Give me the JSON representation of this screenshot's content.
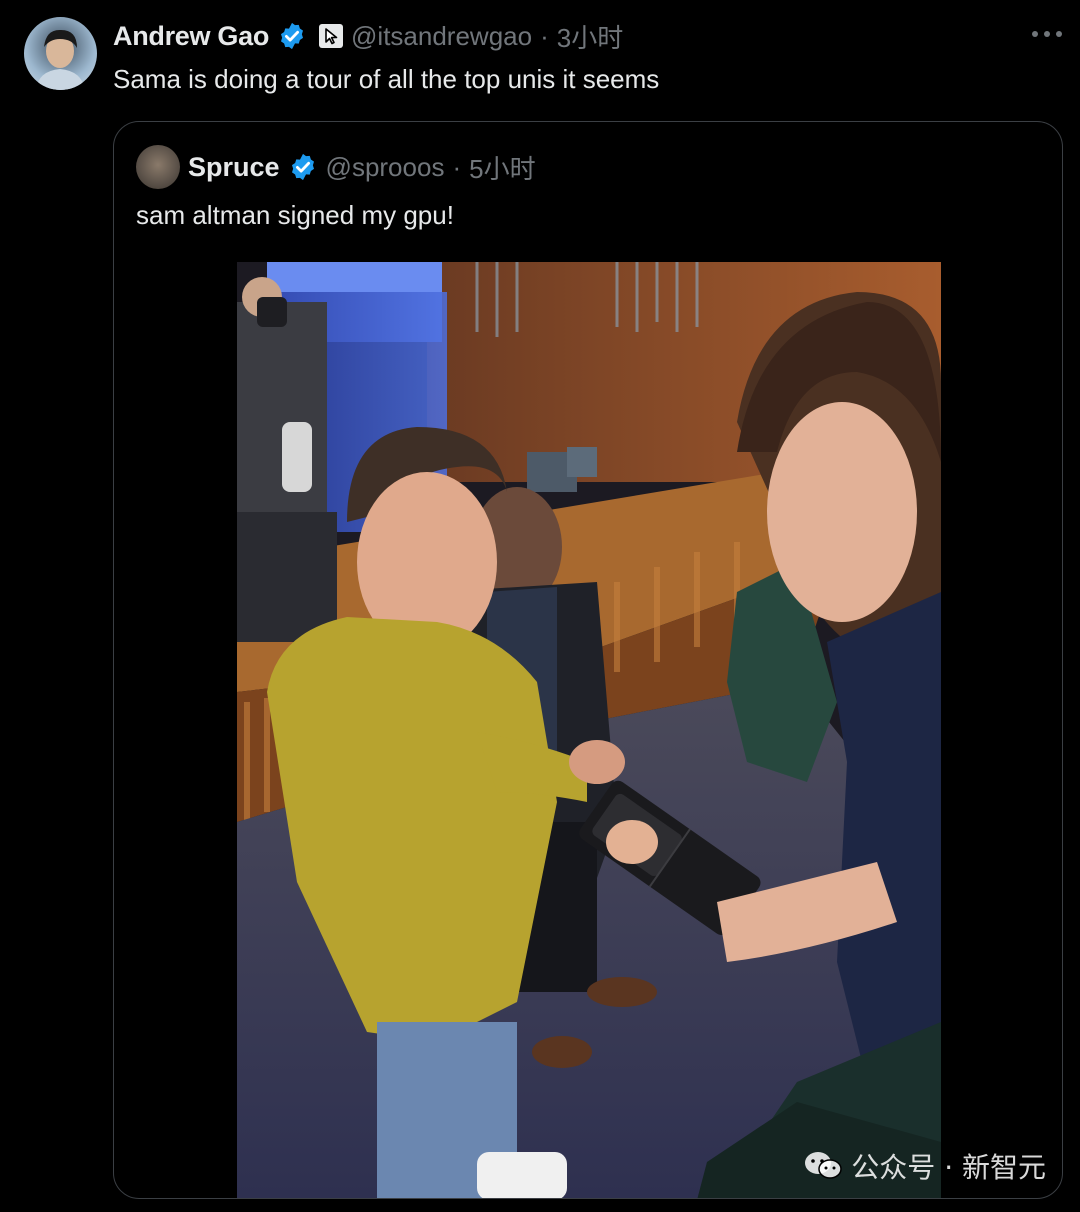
{
  "tweet": {
    "author_name": "Andrew Gao",
    "handle": "@itsandrewgao",
    "separator": "·",
    "time": "3小时",
    "text": "Sama is doing a tour of all the top unis it seems"
  },
  "quote": {
    "author_name": "Spruce",
    "handle": "@sprooos",
    "separator": "·",
    "time": "5小时",
    "text": "sam altman signed my gpu!"
  },
  "watermark": {
    "text": "公众号 · 新智元"
  },
  "colors": {
    "background": "#000000",
    "text_primary": "#e7e9ea",
    "text_secondary": "#71767b",
    "verified_blue": "#1d9bf0",
    "border": "#3b3f44"
  },
  "icons": {
    "verified": "verified-badge-icon",
    "automated": "cursor-icon",
    "more": "more-dots-icon",
    "wechat": "wechat-icon"
  }
}
